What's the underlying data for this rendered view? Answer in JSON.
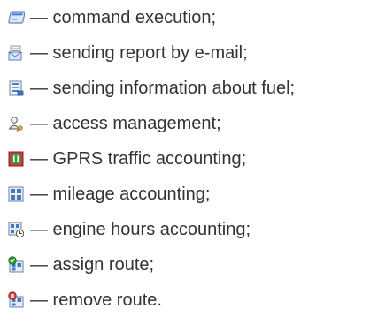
{
  "items": [
    {
      "icon": "command-execution-icon",
      "text": "— command execution;"
    },
    {
      "icon": "email-report-icon",
      "text": "— sending report by e-mail;"
    },
    {
      "icon": "fuel-information-icon",
      "text": "— sending information about fuel;"
    },
    {
      "icon": "access-management-icon",
      "text": "— access management;"
    },
    {
      "icon": "gprs-traffic-icon",
      "text": "— GPRS traffic accounting;"
    },
    {
      "icon": "mileage-accounting-icon",
      "text": "— mileage accounting;"
    },
    {
      "icon": "engine-hours-icon",
      "text": "— engine hours accounting;"
    },
    {
      "icon": "assign-route-icon",
      "text": "— assign route;"
    },
    {
      "icon": "remove-route-icon",
      "text": "— remove route."
    }
  ],
  "colors": {
    "text": "#333333",
    "icon_blue": "#3a7bd5",
    "icon_green": "#2e9e3a",
    "icon_red": "#d83a3a"
  }
}
